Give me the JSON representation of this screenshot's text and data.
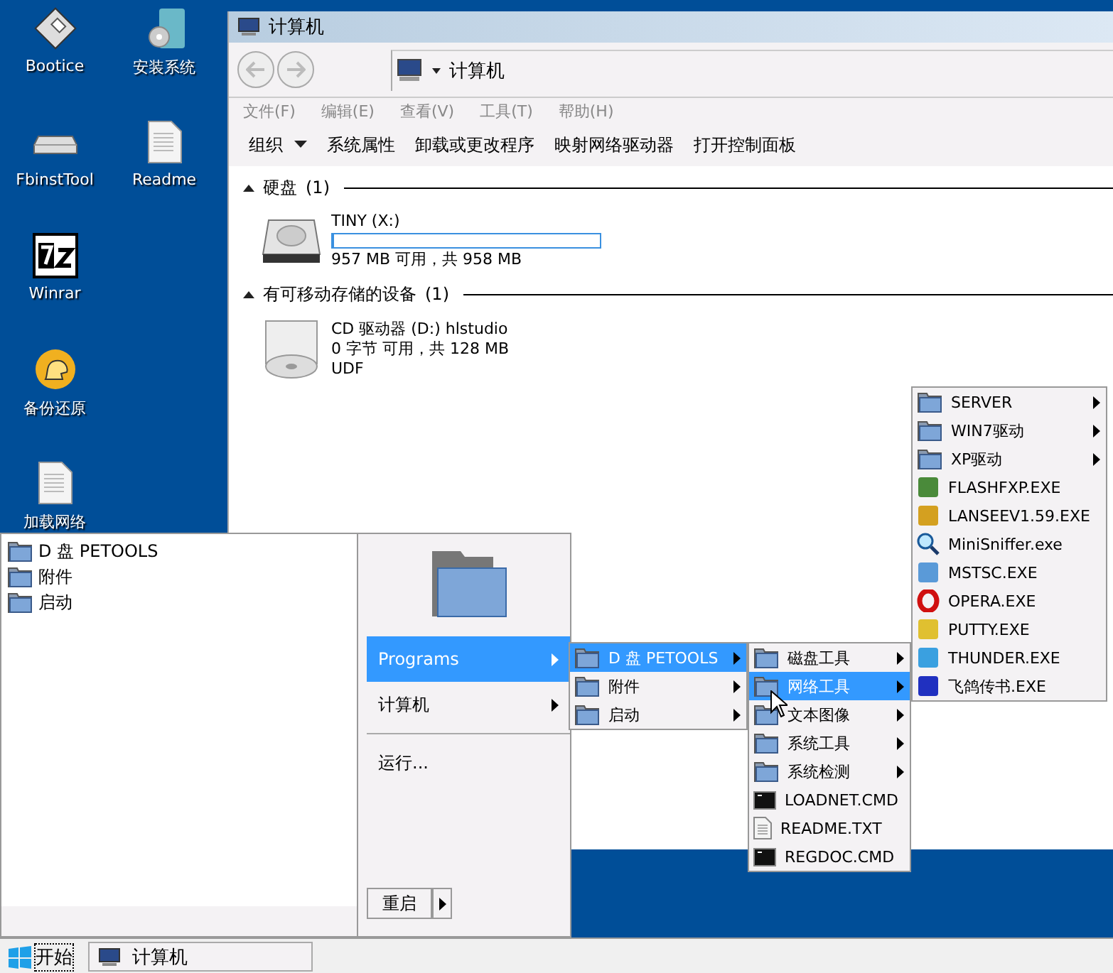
{
  "desktop_icons": [
    {
      "label": "Bootice",
      "kind": "floppy"
    },
    {
      "label": "安装系统",
      "kind": "installer"
    },
    {
      "label": "FbinstTool",
      "kind": "drive"
    },
    {
      "label": "Readme",
      "kind": "document"
    },
    {
      "label": "Winrar",
      "kind": "archive"
    },
    {
      "label": "备份还原",
      "kind": "ghost"
    },
    {
      "label": "加载网络",
      "kind": "document"
    }
  ],
  "explorer": {
    "title": "计算机",
    "address": "计算机",
    "menu_bar": [
      "文件(F)",
      "编辑(E)",
      "查看(V)",
      "工具(T)",
      "帮助(H)"
    ],
    "toolbar": [
      {
        "label": "组织",
        "dropdown": true
      },
      {
        "label": "系统属性",
        "dropdown": false
      },
      {
        "label": "卸载或更改程序",
        "dropdown": false
      },
      {
        "label": "映射网络驱动器",
        "dropdown": false
      },
      {
        "label": "打开控制面板",
        "dropdown": false
      }
    ],
    "groups": [
      {
        "title": "硬盘",
        "count": "(1)",
        "expanded": true,
        "items": [
          {
            "kind": "hdd",
            "lines": [
              "TINY (X:)",
              "957 MB 可用，共 958 MB"
            ],
            "level": 0
          }
        ]
      },
      {
        "title": "有可移动存储的设备",
        "count": "(1)",
        "expanded": true,
        "items": [
          {
            "kind": "cd",
            "lines": [
              "CD 驱动器 (D:) hlstudio",
              "0 字节 可用，共 128 MB",
              "UDF"
            ]
          }
        ]
      }
    ]
  },
  "start_menu": {
    "recent": [
      {
        "label": "D 盘 PETOOLS"
      },
      {
        "label": "附件"
      },
      {
        "label": "启动"
      }
    ],
    "items": [
      {
        "label": "Programs",
        "submenu": true,
        "selected": true
      },
      {
        "label": "计算机",
        "submenu": true,
        "selected": false
      }
    ],
    "run": "运行...",
    "restart": "重启"
  },
  "submenus": [
    {
      "items": [
        {
          "label": "D 盘 PETOOLS",
          "kind": "folder",
          "submenu": true,
          "selected": true
        },
        {
          "label": "附件",
          "kind": "folder",
          "submenu": true,
          "selected": false
        },
        {
          "label": "启动",
          "kind": "folder",
          "submenu": true,
          "selected": false
        }
      ]
    },
    {
      "items": [
        {
          "label": "磁盘工具",
          "kind": "folder",
          "submenu": true,
          "selected": false
        },
        {
          "label": "网络工具",
          "kind": "folder",
          "submenu": true,
          "selected": true
        },
        {
          "label": "文本图像",
          "kind": "folder",
          "submenu": true,
          "selected": false
        },
        {
          "label": "系统工具",
          "kind": "folder",
          "submenu": true,
          "selected": false
        },
        {
          "label": "系统检测",
          "kind": "folder",
          "submenu": true,
          "selected": false
        },
        {
          "label": "LOADNET.CMD",
          "kind": "console",
          "submenu": false,
          "selected": false
        },
        {
          "label": "README.TXT",
          "kind": "document",
          "submenu": false,
          "selected": false
        },
        {
          "label": "REGDOC.CMD",
          "kind": "console",
          "submenu": false,
          "selected": false
        }
      ]
    },
    {
      "items": [
        {
          "label": "SERVER",
          "kind": "folder",
          "submenu": true,
          "selected": false
        },
        {
          "label": "WIN7驱动",
          "kind": "folder",
          "submenu": true,
          "selected": false
        },
        {
          "label": "XP驱动",
          "kind": "folder",
          "submenu": true,
          "selected": false
        },
        {
          "label": "FLASHFXP.EXE",
          "kind": "app",
          "color": "#4a8a3a",
          "submenu": false,
          "selected": false
        },
        {
          "label": "LANSEEV1.59.EXE",
          "kind": "app",
          "color": "#d4a020",
          "submenu": false,
          "selected": false
        },
        {
          "label": "MiniSniffer.exe",
          "kind": "magnifier",
          "submenu": false,
          "selected": false
        },
        {
          "label": "MSTSC.EXE",
          "kind": "app",
          "color": "#5a9ad8",
          "submenu": false,
          "selected": false
        },
        {
          "label": "OPERA.EXE",
          "kind": "ring",
          "color": "#d01010",
          "submenu": false,
          "selected": false
        },
        {
          "label": "PUTTY.EXE",
          "kind": "app",
          "color": "#e0c030",
          "submenu": false,
          "selected": false
        },
        {
          "label": "THUNDER.EXE",
          "kind": "app",
          "color": "#3aa0e0",
          "submenu": false,
          "selected": false
        },
        {
          "label": "飞鸽传书.EXE",
          "kind": "app",
          "color": "#2030c0",
          "submenu": false,
          "selected": false
        }
      ]
    }
  ],
  "taskbar": {
    "start": "开始",
    "tasks": [
      {
        "label": "计算机"
      }
    ]
  }
}
